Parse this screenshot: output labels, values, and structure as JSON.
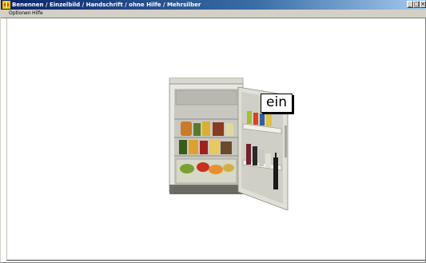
{
  "window": {
    "title": "Benennen / Einzelbild / Handschrift / ohne Hilfe / Mehrsilber"
  },
  "menu": {
    "items": [
      {
        "label": "Optionen"
      },
      {
        "label": "Hilfe"
      }
    ]
  },
  "controls": {
    "minimize": "_",
    "maximize": "□",
    "close": "×"
  },
  "main": {
    "image_subject": "fridge-icon",
    "answer_text": "ein"
  }
}
